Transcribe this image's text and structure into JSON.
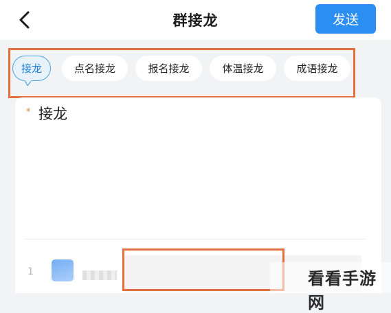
{
  "header": {
    "title": "群接龙",
    "send_label": "发送"
  },
  "tabs": [
    {
      "label": "接龙",
      "active": true
    },
    {
      "label": "点名接龙",
      "active": false
    },
    {
      "label": "报名接龙",
      "active": false
    },
    {
      "label": "体温接龙",
      "active": false
    },
    {
      "label": "成语接龙",
      "active": false
    }
  ],
  "form": {
    "required_mark": "*",
    "field_title": "接龙",
    "first_row_index": "1"
  },
  "watermark": "看看手游网",
  "colors": {
    "accent": "#2a8ef3",
    "highlight": "#e2703e",
    "active_tab_text": "#1f7fd4"
  }
}
